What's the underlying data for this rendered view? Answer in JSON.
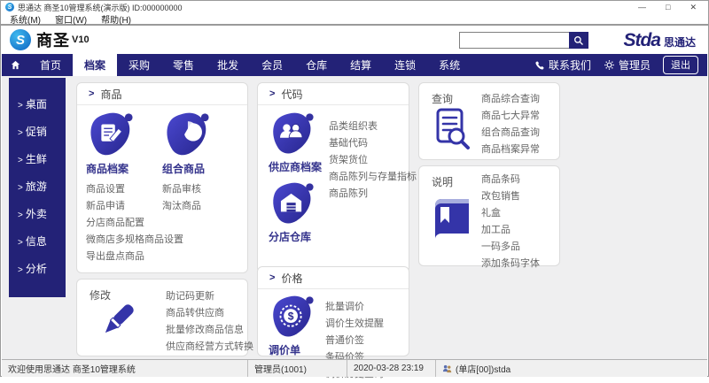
{
  "ui": {
    "chevron": ">"
  },
  "title_bar": {
    "title": "思通达 商圣10管理系统(演示版) ID:000000000",
    "minimize": "—",
    "maximize": "□",
    "close": "✕"
  },
  "menu_bar": {
    "items": [
      "系统(M)",
      "窗口(W)",
      "帮助(H)"
    ]
  },
  "header": {
    "logo_initial": "S",
    "logo_text": "商圣",
    "logo_version": "V10",
    "search_value": "",
    "brand": "Stda",
    "brand_suffix": "思通达"
  },
  "nav": {
    "items": [
      "首页",
      "档案",
      "采购",
      "零售",
      "批发",
      "会员",
      "仓库",
      "结算",
      "连锁",
      "系统"
    ],
    "active": "档案",
    "contact": "联系我们",
    "admin": "管理员",
    "logout": "退出"
  },
  "sidebar": {
    "items": [
      "桌面",
      "促销",
      "生鲜",
      "旅游",
      "外卖",
      "信息",
      "分析"
    ]
  },
  "cards": {
    "goods": {
      "title": "商品",
      "icon1_label": "商品档案",
      "icon2_label": "组合商品",
      "links_col1": [
        "商品设置",
        "新品申请",
        "分店商品配置",
        "微商店多规格商品设置",
        "导出盘点商品"
      ],
      "links_col2": [
        "新品审核",
        "淘汰商品"
      ]
    },
    "code": {
      "title": "代码",
      "icon1_label": "供应商档案",
      "icon2_label": "分店仓库",
      "links": [
        "品类组织表",
        "基础代码",
        "货架货位",
        "商品陈列与存量指标",
        "商品陈列"
      ]
    },
    "query": {
      "title": "查询",
      "links": [
        "商品综合查询",
        "商品七大异常",
        "组合商品查询",
        "商品档案异常"
      ]
    },
    "desc": {
      "title": "说明",
      "links": [
        "商品条码",
        "改包销售",
        "礼盒",
        "加工品",
        "一码多品",
        "添加条码字体"
      ]
    },
    "modify": {
      "title": "修改",
      "links": [
        "助记码更新",
        "商品转供应商",
        "批量修改商品信息",
        "供应商经营方式转换"
      ]
    },
    "price": {
      "title": "价格",
      "icon_label": "调价单",
      "links": [
        "批量调价",
        "调价生效提醒",
        "普通价签",
        "条码价签",
        "调价历史查询"
      ]
    }
  },
  "status_bar": {
    "welcome": "欢迎使用思通达 商圣10管理系统",
    "user": "管理员(1001)",
    "datetime": "2020-03-28 23:19",
    "store": "(单店[00])stda"
  },
  "colors": {
    "navy": "#232277",
    "icon_blue": "#3434a8",
    "page_bg": "#efeff0"
  }
}
